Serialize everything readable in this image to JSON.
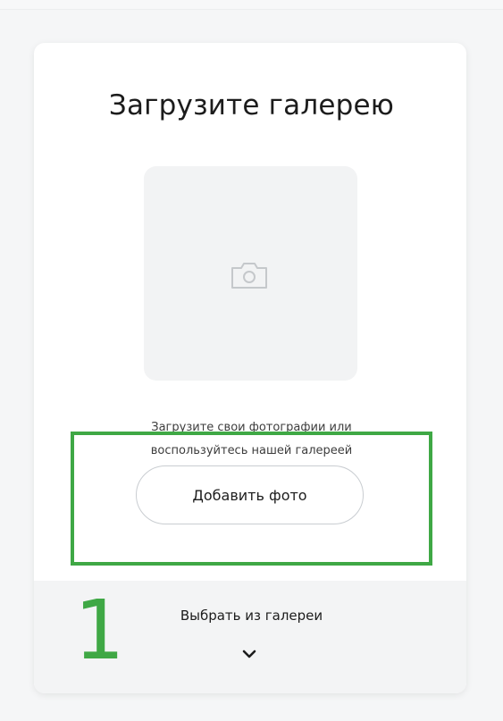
{
  "upload": {
    "title": "Загрузите галерею",
    "description_line1": "Загрузите свои фотографии или",
    "description_line2": "воспользуйтесь нашей галереей",
    "add_photo_label": "Добавить фото"
  },
  "gallery": {
    "select_label": "Выбрать из галереи"
  },
  "annotation": {
    "step_number": "1",
    "highlight_color": "#3fa845"
  },
  "icons": {
    "placeholder_icon": "camera-icon",
    "expand_icon": "chevron-down-icon"
  }
}
